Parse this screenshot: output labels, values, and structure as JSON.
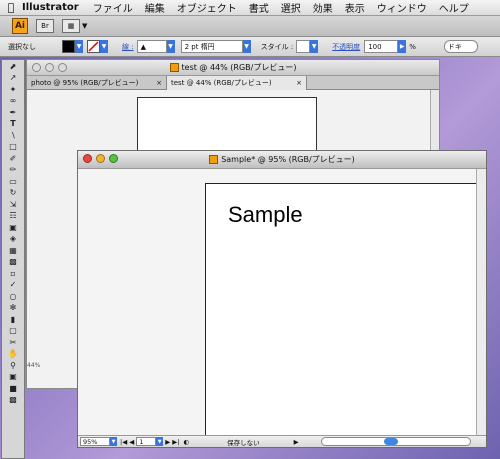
{
  "menubar": {
    "apple": "",
    "app_name": "Illustrator",
    "items": [
      "ファイル",
      "編集",
      "オブジェクト",
      "書式",
      "選択",
      "効果",
      "表示",
      "ウィンドウ",
      "ヘルプ"
    ]
  },
  "app_toolbar": {
    "logo": "Ai",
    "bridge_label": "Br"
  },
  "control_bar": {
    "selection_status": "選択なし",
    "stroke_label": "線 :",
    "stroke_weight": "2 pt 楕円",
    "style_label": "スタイル :",
    "opacity_link": "不透明度",
    "opacity_value": "100",
    "opacity_unit": "%",
    "right_label": "ドキ"
  },
  "back_window": {
    "title": "test @ 44% (RGB/プレビュー)",
    "tabs": [
      {
        "label": "photo @ 95% (RGB/プレビュー)",
        "close": "×"
      },
      {
        "label": "test @ 44% (RGB/プレビュー)",
        "close": "×"
      }
    ],
    "zoom": "44%"
  },
  "front_window": {
    "title": "Sample* @ 95% (RGB/プレビュー)",
    "artboard_text": "Sample",
    "status": {
      "zoom": "95%",
      "page": "1",
      "save_status": "保存しない"
    }
  },
  "colors": {
    "accent": "#3a73d9",
    "ai_logo": "#f7a21b",
    "desktop": "#8a79c4"
  }
}
